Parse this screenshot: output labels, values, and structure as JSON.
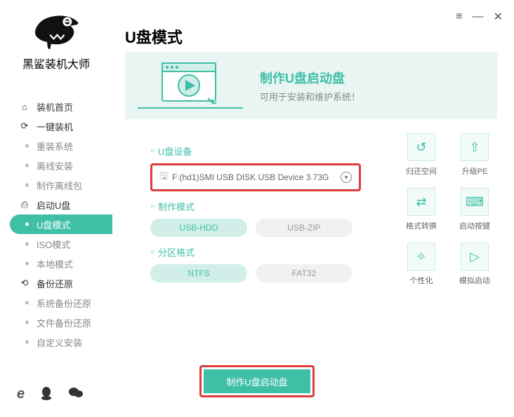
{
  "app_name": "黑鲨装机大师",
  "window_controls": {
    "menu": "≡",
    "min": "—",
    "close": "✕"
  },
  "sidebar": {
    "items": [
      {
        "label": "装机首页",
        "icon": "⌂",
        "subitems": []
      },
      {
        "label": "一键装机",
        "icon": "⟳",
        "subitems": [
          {
            "label": "重装系统"
          },
          {
            "label": "离线安装"
          },
          {
            "label": "制作离线包"
          }
        ]
      },
      {
        "label": "启动U盘",
        "icon": "⎙",
        "subitems": [
          {
            "label": "U盘模式",
            "active": true
          },
          {
            "label": "ISO模式"
          },
          {
            "label": "本地模式"
          }
        ]
      },
      {
        "label": "备份还原",
        "icon": "⟲",
        "subitems": [
          {
            "label": "系统备份还原"
          },
          {
            "label": "文件备份还原"
          },
          {
            "label": "自定义安装"
          }
        ]
      }
    ]
  },
  "social": {
    "ie": "e",
    "qq": "●",
    "wechat": "✉"
  },
  "main": {
    "title": "U盘模式",
    "banner_title": "制作U盘启动盘",
    "banner_sub": "可用于安装和维护系统！",
    "sections": {
      "device_label": "U盘设备",
      "device_value": "F:(hd1)SMI USB DISK USB Device 3.73G",
      "mode_label": "制作模式",
      "modes": [
        {
          "label": "USB-HDD",
          "selected": true
        },
        {
          "label": "USB-ZIP",
          "selected": false
        }
      ],
      "format_label": "分区格式",
      "formats": [
        {
          "label": "NTFS",
          "selected": true
        },
        {
          "label": "FAT32",
          "selected": false
        }
      ]
    },
    "actions": [
      {
        "label": "归还空间",
        "icon": "↺"
      },
      {
        "label": "升级PE",
        "icon": "⇧"
      },
      {
        "label": "格式转换",
        "icon": "⇄"
      },
      {
        "label": "启动按键",
        "icon": "⌨"
      },
      {
        "label": "个性化",
        "icon": "✧"
      },
      {
        "label": "模拟启动",
        "icon": "▷"
      }
    ],
    "primary_button": "制作U盘启动盘"
  }
}
